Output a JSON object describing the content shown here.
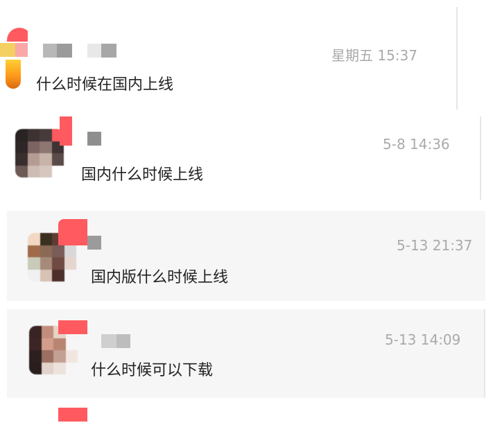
{
  "comments": [
    {
      "time": "星期五 15:37",
      "text": "什么时候在国内上线"
    },
    {
      "time": "5-8 14:36",
      "text": "国内什么时候上线"
    },
    {
      "time": "5-13 21:37",
      "text": "国内版什么时候上线"
    },
    {
      "time": "5-13 14:09",
      "text": "什么时候可以下载"
    }
  ],
  "colors": {
    "badge": "#ff5a5f",
    "card_alt_background": "#f6f6f6",
    "time_text": "#aaaaaa",
    "message_text": "#222222"
  }
}
